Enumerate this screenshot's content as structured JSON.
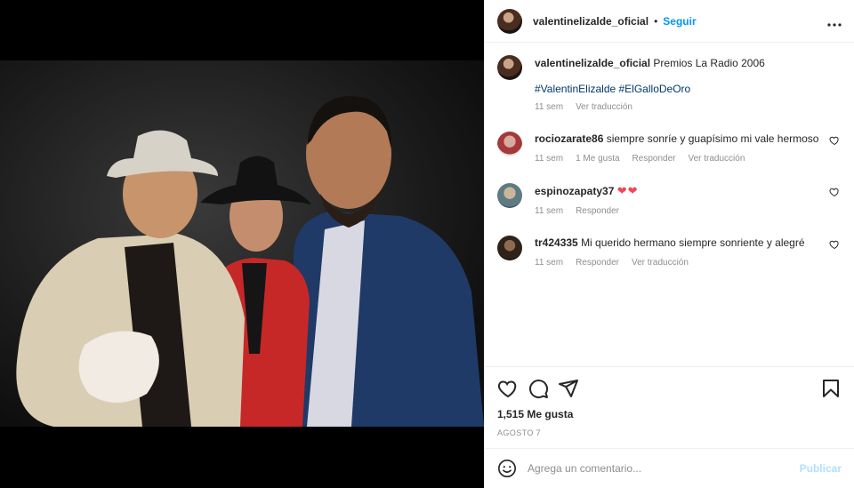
{
  "post": {
    "username": "valentinelizalde_oficial",
    "separator": "•",
    "follow_label": "Seguir",
    "more_label": "•••",
    "caption": {
      "username": "valentinelizalde_oficial",
      "text": "Premios La Radio 2006",
      "hashtags": "#ValentinElizalde #ElGalloDeOro",
      "time": "11 sem",
      "translate": "Ver traducción"
    },
    "comments": [
      {
        "username": "rociozarate86",
        "text": "siempre sonríe y guapísimo mi vale hermoso",
        "time": "11 sem",
        "likes": "1 Me gusta",
        "reply": "Responder",
        "translate": "Ver traducción"
      },
      {
        "username": "espinozapaty37",
        "text": "❤❤",
        "time": "11 sem",
        "reply": "Responder"
      },
      {
        "username": "tr424335",
        "text": "Mi querido hermano siempre sonriente y alegré",
        "time": "11 sem",
        "reply": "Responder",
        "translate": "Ver traducción"
      }
    ],
    "likes_count": "1,515 Me gusta",
    "date": "AGOSTO 7",
    "composer": {
      "placeholder": "Agrega un comentario...",
      "post_label": "Publicar"
    }
  },
  "icons": {
    "like": "heart-icon",
    "comment": "comment-icon",
    "share": "share-icon",
    "save": "bookmark-icon",
    "emoji": "emoji-icon"
  },
  "colors": {
    "link": "#0095f6",
    "hashtag": "#00376b",
    "muted": "#8e8e8e",
    "post_disabled": "#b2dffc",
    "heart_red": "#ed4956"
  }
}
